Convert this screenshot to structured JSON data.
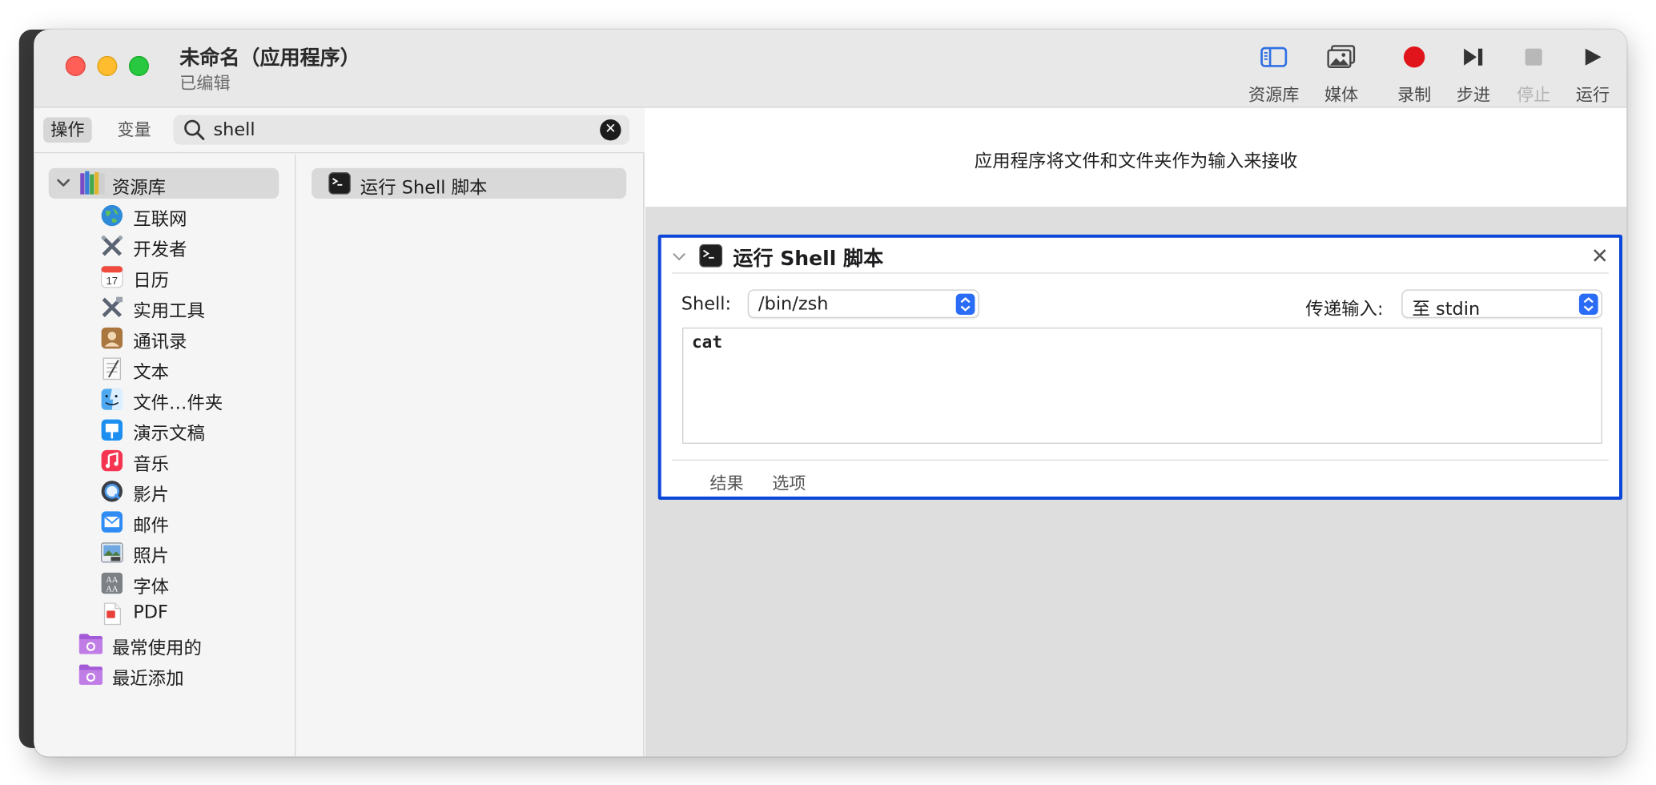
{
  "window": {
    "title": "未命名（应用程序）",
    "subtitle": "已编辑"
  },
  "toolbar": {
    "items": [
      {
        "label": "资源库",
        "icon": "sidebar-icon",
        "enabled": true
      },
      {
        "label": "媒体",
        "icon": "photo-icon",
        "enabled": true
      },
      {
        "label": "录制",
        "icon": "record-icon",
        "enabled": true
      },
      {
        "label": "步进",
        "icon": "step-icon",
        "enabled": true
      },
      {
        "label": "停止",
        "icon": "stop-icon",
        "enabled": false
      },
      {
        "label": "运行",
        "icon": "play-icon",
        "enabled": true
      }
    ]
  },
  "filter": {
    "tabs": [
      "操作",
      "变量"
    ],
    "active_tab": "操作",
    "search_value": "shell"
  },
  "library": {
    "root_label": "资源库",
    "items": [
      {
        "label": "互联网",
        "icon": "globe-icon"
      },
      {
        "label": "开发者",
        "icon": "developer-tools-icon"
      },
      {
        "label": "日历",
        "icon": "calendar-icon",
        "badge": "17"
      },
      {
        "label": "实用工具",
        "icon": "utilities-icon"
      },
      {
        "label": "通讯录",
        "icon": "contacts-icon"
      },
      {
        "label": "文本",
        "icon": "text-document-icon"
      },
      {
        "label": "文件…件夹",
        "icon": "finder-icon"
      },
      {
        "label": "演示文稿",
        "icon": "keynote-icon"
      },
      {
        "label": "音乐",
        "icon": "music-icon"
      },
      {
        "label": "影片",
        "icon": "quicktime-icon"
      },
      {
        "label": "邮件",
        "icon": "mail-icon"
      },
      {
        "label": "照片",
        "icon": "photos-icon"
      },
      {
        "label": "字体",
        "icon": "font-icon",
        "badge": "AA"
      },
      {
        "label": "PDF",
        "icon": "pdf-icon"
      }
    ],
    "smart_groups": [
      {
        "label": "最常使用的",
        "icon": "smart-folder-icon"
      },
      {
        "label": "最近添加",
        "icon": "smart-folder-icon"
      }
    ]
  },
  "actions": {
    "items": [
      {
        "label": "运行 Shell 脚本",
        "icon": "terminal-icon"
      }
    ]
  },
  "workflow": {
    "header_message": "应用程序将文件和文件夹作为输入来接收",
    "card": {
      "title": "运行 Shell 脚本",
      "shell_label": "Shell:",
      "shell_value": "/bin/zsh",
      "pass_input_label": "传递输入:",
      "pass_input_value": "至 stdin",
      "script": "cat",
      "footer_tabs": [
        "结果",
        "选项"
      ]
    }
  },
  "colors": {
    "selection_border": "#0b46d8",
    "record": "#e0141b",
    "popup_stepper": "#2b6cf6",
    "toolbar_accent": "#2f6fe4"
  }
}
